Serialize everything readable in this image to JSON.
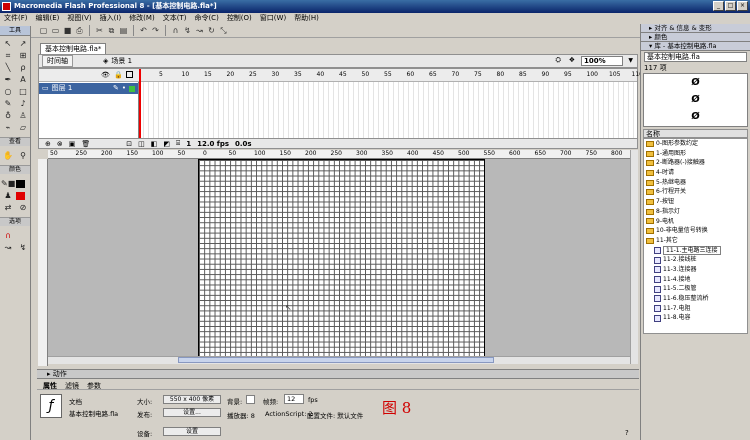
{
  "window": {
    "title": "Macromedia Flash Professional 8 - [基本控制电路.fla*]"
  },
  "menu": [
    "文件(F)",
    "编辑(E)",
    "视图(V)",
    "插入(I)",
    "修改(M)",
    "文本(T)",
    "命令(C)",
    "控制(O)",
    "窗口(W)",
    "帮助(H)"
  ],
  "tools": {
    "header": "工具",
    "view_label": "查看",
    "color_label": "颜色",
    "options_label": "选项"
  },
  "document": {
    "tab": "基本控制电路.fla*"
  },
  "timeline": {
    "button": "时间轴",
    "scene": "场景 1",
    "zoom": "100%",
    "layer": "图层 1",
    "frame_numbers": [
      "5",
      "10",
      "15",
      "20",
      "25",
      "30",
      "35",
      "40",
      "45",
      "50",
      "55",
      "60",
      "65",
      "70",
      "75",
      "80",
      "85",
      "90",
      "95",
      "100",
      "105",
      "110"
    ],
    "current_frame": "1",
    "fps": "12.0 fps",
    "time": "0.0s"
  },
  "ruler": {
    "h_ticks": [
      "50",
      "250",
      "200",
      "150",
      "100",
      "50",
      "0",
      "50",
      "100",
      "150",
      "200",
      "250",
      "300",
      "350",
      "400",
      "450",
      "500",
      "550",
      "600",
      "650",
      "700",
      "750",
      "800"
    ]
  },
  "actions": {
    "label": "动作"
  },
  "properties": {
    "tabs": [
      "属性",
      "滤镜",
      "参数"
    ],
    "doc_label": "文档",
    "doc_name": "基本控制电路.fla",
    "size_label": "大小:",
    "size_value": "550 x 400 像素",
    "bg_label": "背景:",
    "fps_label": "帧频:",
    "fps_value": "12",
    "fps_unit": "fps",
    "publish_label": "发布:",
    "settings_btn": "设置...",
    "player_label": "播放器: 8",
    "as_label": "ActionScript: 2",
    "profile_label": "配置文件: 默认文件",
    "device_label": "设备:",
    "device_btn": "设置",
    "figure_label": "图 8"
  },
  "right_panel": {
    "align_header": "对齐 & 信息 & 变形",
    "color_header": "颜色",
    "library_header": "库 - 基本控制电路.fla",
    "library_select": "基本控制电路.fla",
    "item_count": "117 项",
    "name_header": "名称",
    "items": [
      {
        "label": "0-图形参数约定",
        "type": "folder"
      },
      {
        "label": "1-通用图形",
        "type": "folder"
      },
      {
        "label": "2-断路器(-)接触器",
        "type": "folder"
      },
      {
        "label": "4-时请",
        "type": "folder"
      },
      {
        "label": "5-热继电器",
        "type": "folder"
      },
      {
        "label": "6-行程开关",
        "type": "folder"
      },
      {
        "label": "7-按钮",
        "type": "folder"
      },
      {
        "label": "8-指示灯",
        "type": "folder"
      },
      {
        "label": "9-电机",
        "type": "folder"
      },
      {
        "label": "10-非电量信号转换",
        "type": "folder"
      },
      {
        "label": "11-其它",
        "type": "folder"
      },
      {
        "label": "11-1.主电路三连接",
        "type": "symbol",
        "selected": true
      },
      {
        "label": "11-2.接线桩",
        "type": "symbol"
      },
      {
        "label": "11-3.连接器",
        "type": "symbol"
      },
      {
        "label": "11-4.接地",
        "type": "symbol"
      },
      {
        "label": "11-5.二极管",
        "type": "symbol"
      },
      {
        "label": "11-6.稳压整流桥",
        "type": "symbol"
      },
      {
        "label": "11-7.电阻",
        "type": "symbol"
      },
      {
        "label": "11-8.电容",
        "type": "symbol"
      }
    ]
  }
}
